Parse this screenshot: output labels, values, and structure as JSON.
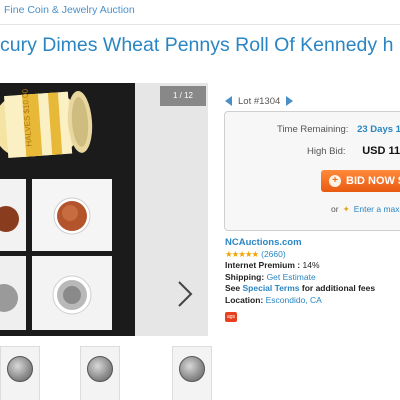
{
  "header": {
    "breadcrumb": "Fine Coin & Jewelry Auction",
    "title": "cury Dimes Wheat Pennys Roll Of Kennedy h"
  },
  "gallery": {
    "counter": "1 / 12",
    "roll_text": "HALVES $10.00"
  },
  "lot": {
    "label": "Lot #1304",
    "time_label": "Time Remaining:",
    "time_value": "23 Days 14",
    "bid_label": "High Bid:",
    "bid_value": "USD 11.",
    "bid_button": "BID NOW $",
    "or_text": "or",
    "max_link": "Enter a maxim"
  },
  "seller": {
    "name": "NCAuctions.com",
    "stars": "★★★★★",
    "rating_count": "(2660)",
    "premium_label": "Internet Premium :",
    "premium_value": "14%",
    "shipping_label": "Shipping:",
    "shipping_link": "Get Estimate",
    "see_text": "See",
    "special_terms_link": "Special Terms",
    "special_terms_suffix": "for additional fees",
    "location_label": "Location:",
    "location_value": "Escondido, CA",
    "badge": "ags"
  },
  "colors": {
    "link_blue": "#2a86c2",
    "bid_orange": "#ef6a18"
  }
}
